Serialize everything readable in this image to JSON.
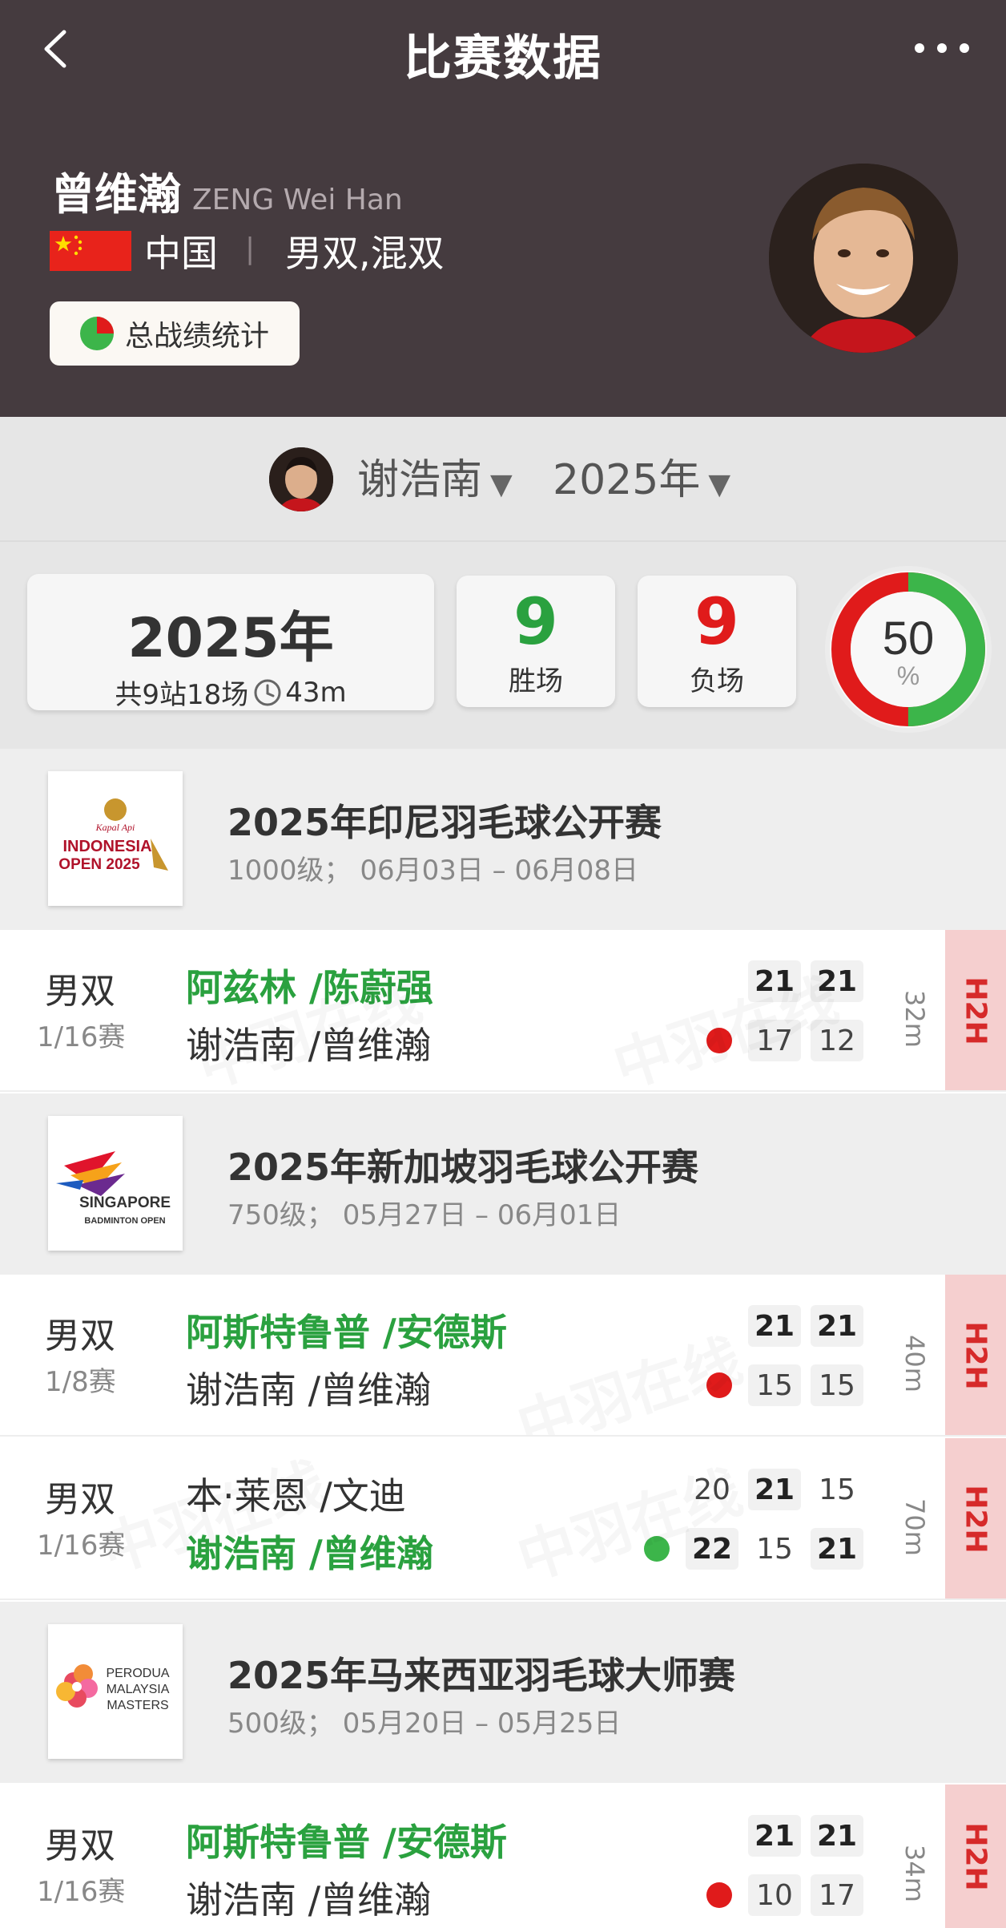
{
  "header": {
    "title": "比赛数据"
  },
  "player": {
    "name_cn": "曾维瀚",
    "name_en": "ZENG Wei Han",
    "country": "中国",
    "separator": "|",
    "events": "男双,混双",
    "stats_button": "总战绩统计"
  },
  "filter": {
    "partner": "谢浩南",
    "year": "2025年",
    "caret": "▼"
  },
  "summary": {
    "year": "2025年",
    "subtitle": "共9站18场",
    "duration": "43m",
    "wins": "9",
    "wins_label": "胜场",
    "losses": "9",
    "losses_label": "负场",
    "win_pct": "50",
    "pct_sign": "%",
    "win_fraction": 0.5
  },
  "tournaments": [
    {
      "name": "2025年印尼羽毛球公开赛",
      "info": "1000级；  06月03日 – 06月08日",
      "logo_line1": "INDONESIA",
      "logo_line2": "OPEN 2025",
      "matches": [
        {
          "category": "男双",
          "round": "1/16赛",
          "team1": "阿兹林 /陈蔚强",
          "team2": "谢浩南 /曾维瀚",
          "winner": 1,
          "scores1": [
            "21",
            "21"
          ],
          "scores2": [
            "17",
            "12"
          ],
          "duration": "32m",
          "h2h": "H2H",
          "result": "loss"
        }
      ]
    },
    {
      "name": "2025年新加坡羽毛球公开赛",
      "info": "750级；  05月27日 – 06月01日",
      "logo_line1": "SINGAPORE",
      "logo_line2": "BADMINTON OPEN",
      "matches": [
        {
          "category": "男双",
          "round": "1/8赛",
          "team1": "阿斯特鲁普 /安德斯",
          "team2": "谢浩南 /曾维瀚",
          "winner": 1,
          "scores1": [
            "21",
            "21"
          ],
          "scores2": [
            "15",
            "15"
          ],
          "duration": "40m",
          "h2h": "H2H",
          "result": "loss"
        },
        {
          "category": "男双",
          "round": "1/16赛",
          "team1": "本·莱恩 /文迪",
          "team2": "谢浩南 /曾维瀚",
          "winner": 2,
          "scores1": [
            "20",
            "21",
            "15"
          ],
          "scores2": [
            "22",
            "15",
            "21"
          ],
          "duration": "70m",
          "h2h": "H2H",
          "result": "win"
        }
      ]
    },
    {
      "name": "2025年马来西亚羽毛球大师赛",
      "info": "500级；  05月20日 – 05月25日",
      "logo_line1": "PERODUA",
      "logo_line2": "MALAYSIA",
      "logo_line3": "MASTERS",
      "matches": [
        {
          "category": "男双",
          "round": "1/16赛",
          "team1": "阿斯特鲁普 /安德斯",
          "team2": "谢浩南 /曾维瀚",
          "winner": 1,
          "scores1": [
            "21",
            "21"
          ],
          "scores2": [
            "10",
            "17"
          ],
          "duration": "34m",
          "h2h": "H2H",
          "result": "loss"
        }
      ]
    }
  ],
  "colors": {
    "header_bg": "#453b3f",
    "win": "#2aa13f",
    "loss": "#e01b1b",
    "h2h_bg": "#f5cfcf",
    "h2h_text": "#d62a2a"
  }
}
